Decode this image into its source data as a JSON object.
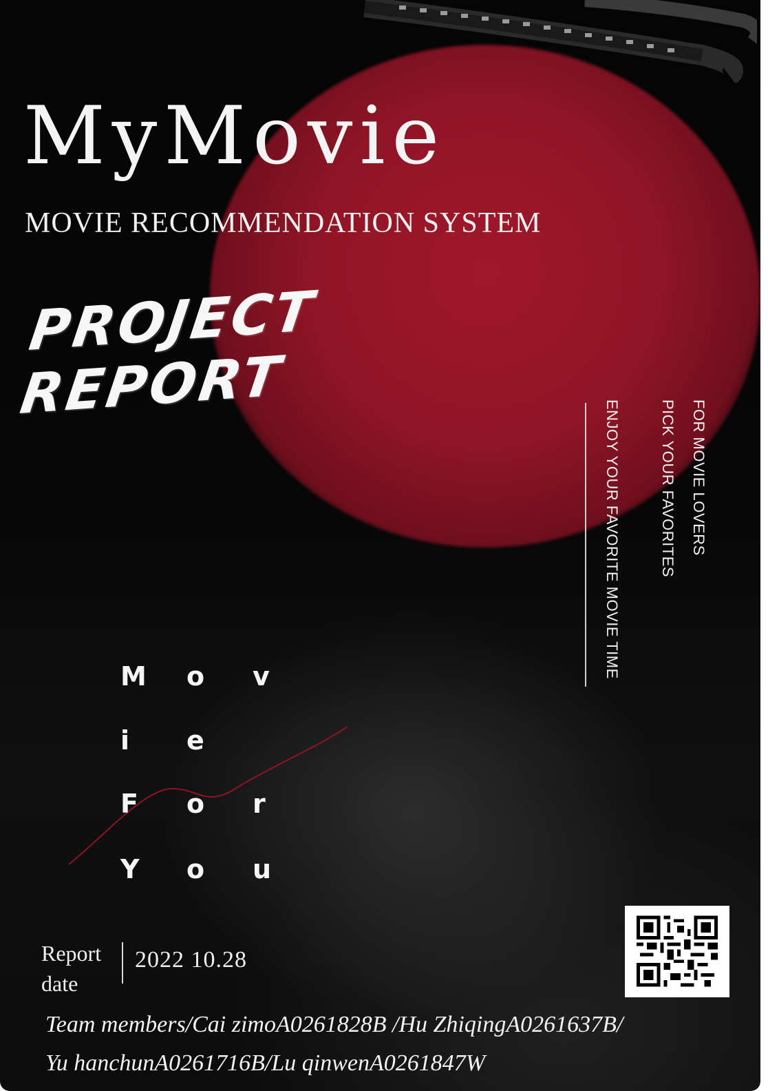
{
  "poster": {
    "title": "MyMovie",
    "subtitle": "MOVIE RECOMMENDATION SYSTEM",
    "headline_line1": "PROJECT",
    "headline_line2": "REPORT",
    "tagline_1": "FOR MOVIE LOVERS",
    "tagline_2": "PICK YOUR FAVORITES",
    "tagline_3": "ENJOY YOUR FAVORITE MOVIE TIME",
    "slogan_rows": [
      [
        "M",
        "o",
        "v"
      ],
      [
        "i",
        "e",
        ""
      ],
      [
        "F",
        "o",
        "r"
      ],
      [
        "Y",
        "o",
        "u"
      ]
    ],
    "report_date_label_1": "Report",
    "report_date_label_2": "date",
    "report_date_value": "2022  10.28",
    "team_line_1": "Team members/Cai zimoA0261828B /Hu ZhiqingA0261637B/",
    "team_line_2": "Yu hanchunA0261716B/Lu qinwenA0261847W"
  },
  "colors": {
    "background": "#050505",
    "accent_red": "#9b1728",
    "text": "#f4f4f4"
  },
  "icons": {
    "film": "film-strip-icon",
    "qr": "qr-code-icon"
  }
}
